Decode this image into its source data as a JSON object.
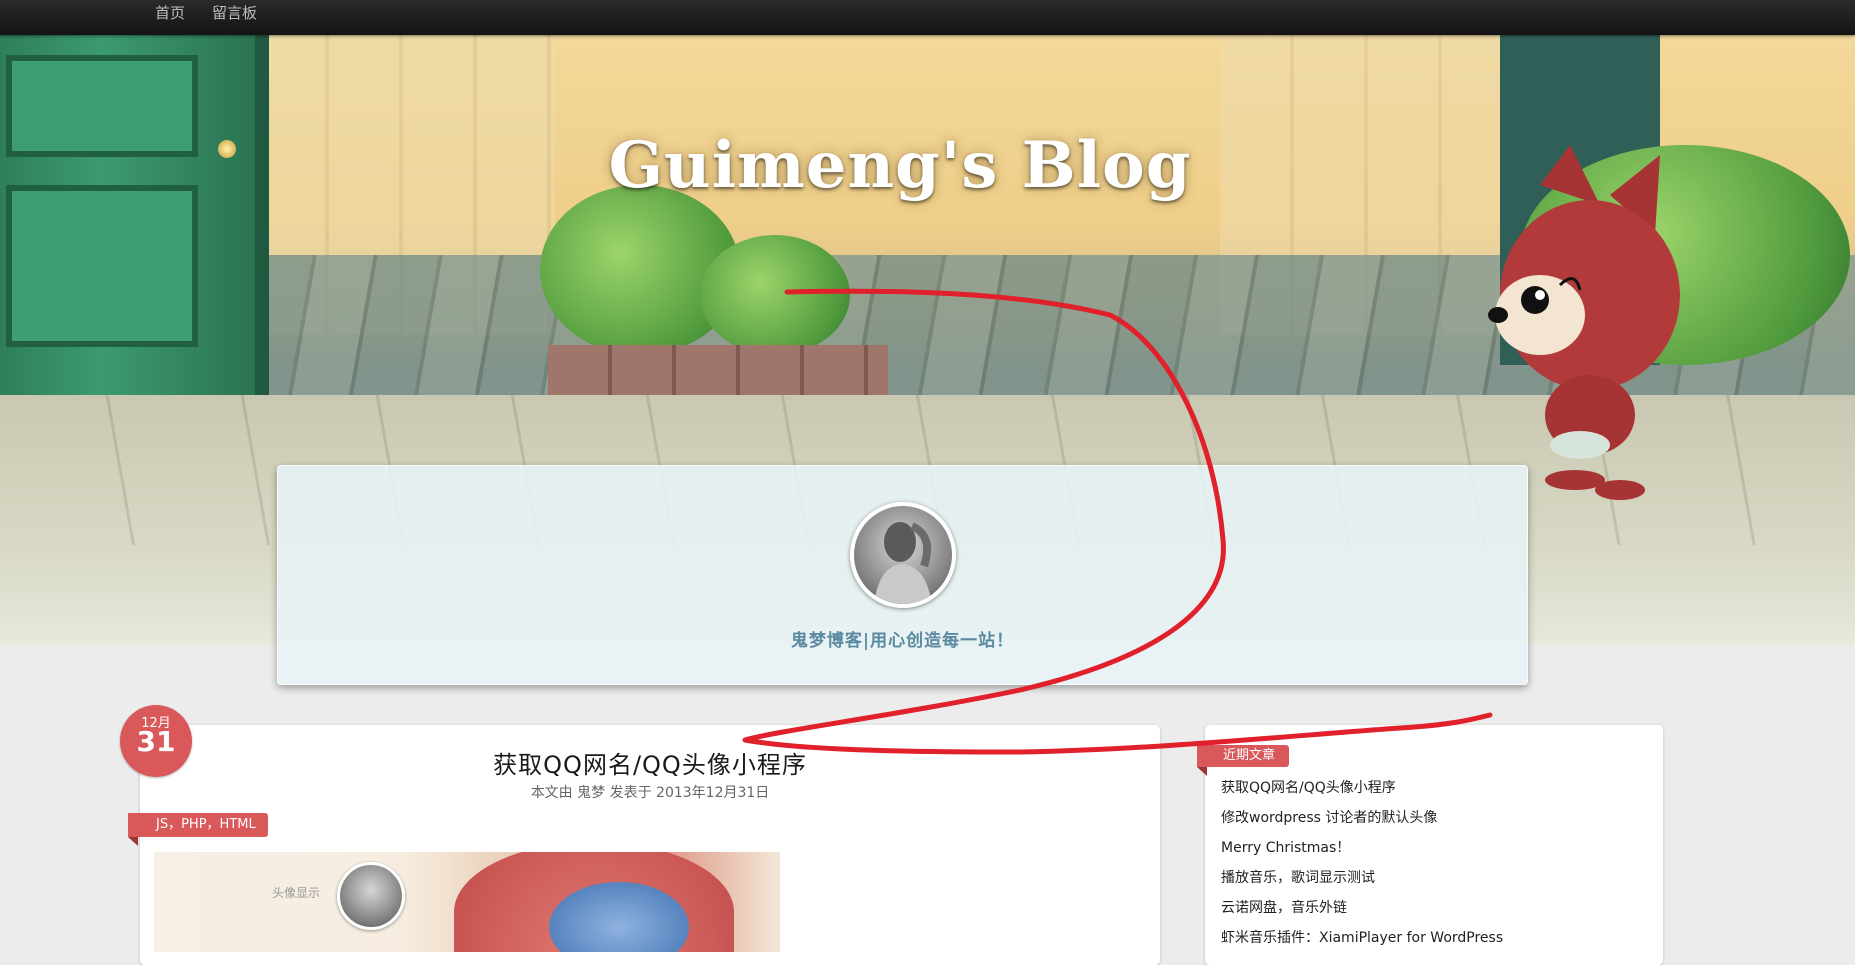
{
  "nav": {
    "items": [
      "首页",
      "留言板"
    ]
  },
  "header": {
    "site_title": "Guimeng's Blog",
    "tagline": "鬼梦博客|用心创造每一站！"
  },
  "post": {
    "date_month": "12月",
    "date_day": "31",
    "title": "获取QQ网名/QQ头像小程序",
    "meta": "本文由 鬼梦 发表于 2013年12月31日",
    "tags": "JS，PHP，HTML",
    "thumbnail_label": "头像显示"
  },
  "sidebar": {
    "recent_title": "近期文章",
    "recent_posts": [
      "获取QQ网名/QQ头像小程序",
      "修改wordpress 讨论者的默认头像",
      "Merry Christmas！",
      "播放音乐，歌词显示测试",
      "云诺网盘，音乐外链",
      "虾米音乐插件：XiamiPlayer for WordPress"
    ]
  },
  "colors": {
    "accent": "#d9595b",
    "tagline": "#5b8aa0",
    "annotation": "#e0202a"
  }
}
